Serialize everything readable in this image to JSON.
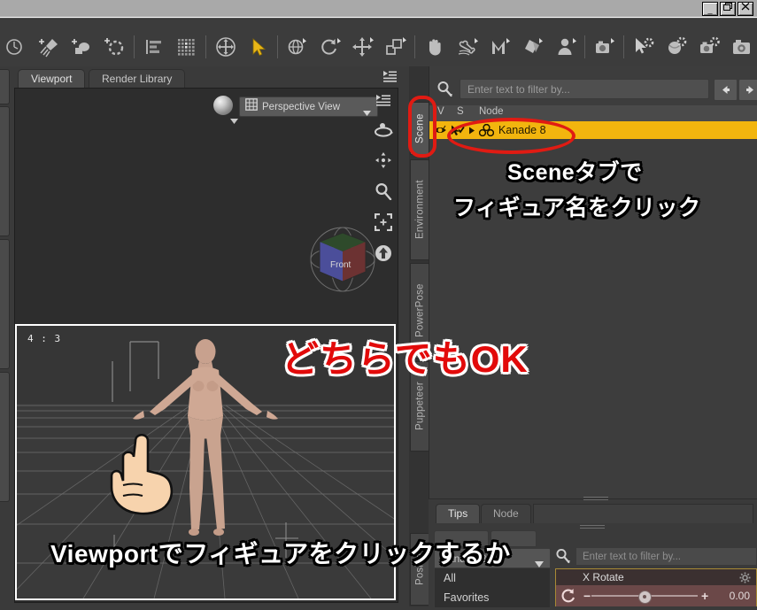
{
  "window": {
    "buttons": [
      {
        "name": "minimize-button",
        "glyph": "_"
      },
      {
        "name": "restore-button",
        "glyph": "❐"
      },
      {
        "name": "close-button",
        "glyph": "✕"
      }
    ]
  },
  "toolbar": {
    "icons": [
      {
        "name": "render-settings-icon",
        "title": "Render Settings"
      },
      {
        "name": "create-light-icon",
        "title": "Create Light"
      },
      {
        "name": "create-camera-icon",
        "title": "Create Camera"
      },
      {
        "name": "create-null-icon",
        "title": "Create Null"
      },
      {
        "name": "align-icon",
        "title": "Align"
      },
      {
        "name": "grid-snap-icon",
        "title": "Grid"
      },
      {
        "name": "universal-tool-icon",
        "title": "Universal Tool"
      },
      {
        "name": "node-selection-icon",
        "title": "Node Selection Tool"
      },
      {
        "name": "rotate-orbit-icon",
        "title": "Rotate"
      },
      {
        "name": "rotate-tool-icon",
        "title": "Rotate Tool"
      },
      {
        "name": "translate-tool-icon",
        "title": "Translate Tool"
      },
      {
        "name": "scale-tool-icon",
        "title": "Scale Tool"
      },
      {
        "name": "pan-hand-icon",
        "title": "Hand / Pan"
      },
      {
        "name": "bone-tool-icon",
        "title": "Joint Editor"
      },
      {
        "name": "morph-tool-icon",
        "title": "Morph Tool"
      },
      {
        "name": "surface-tool-icon",
        "title": "Surface Selection"
      },
      {
        "name": "figure-tool-icon",
        "title": "Figure Tool"
      },
      {
        "name": "camera-tool-icon",
        "title": "Camera Tool"
      },
      {
        "name": "selection-options-icon",
        "title": "Selection Options"
      },
      {
        "name": "render-preview-icon",
        "title": "Preview Render"
      },
      {
        "name": "render-settings-camera-icon",
        "title": "Render Settings"
      },
      {
        "name": "render-icon",
        "title": "Render"
      },
      {
        "name": "daz-studio-logo-icon",
        "title": "DAZ Studio"
      },
      {
        "name": "toolbar-overflow-icon",
        "title": "More"
      }
    ],
    "active_index": 7
  },
  "viewport": {
    "tabs": [
      {
        "label": "Viewport",
        "selected": true
      },
      {
        "label": "Render Library",
        "selected": false
      }
    ],
    "view_selector": "Perspective View",
    "viewcube_label": "Front",
    "aspect_ratio": "4 : 3",
    "side_tools": [
      {
        "name": "viewport-menu-icon"
      },
      {
        "name": "orbit-icon"
      },
      {
        "name": "pan-icon"
      },
      {
        "name": "zoom-icon"
      },
      {
        "name": "frame-icon"
      },
      {
        "name": "reset-view-icon"
      }
    ]
  },
  "vertical_tabs": [
    {
      "label": "Scene",
      "selected": true
    },
    {
      "label": "Environment",
      "selected": false
    },
    {
      "label": "PowerPose",
      "selected": false
    },
    {
      "label": "Puppeteer",
      "selected": false
    },
    {
      "label": "Posing",
      "selected": false
    }
  ],
  "scene_pane": {
    "filter_placeholder": "Enter text to filter by...",
    "filter_value": "",
    "nav_prev": "◀",
    "nav_next": "▶",
    "columns": [
      "V",
      "S",
      "Node"
    ],
    "rows": [
      {
        "node": "Kanade 8",
        "selected": true
      }
    ]
  },
  "tips_pane": {
    "tabs": [
      {
        "label": "Tips",
        "selected": true
      },
      {
        "label": "Node",
        "selected": false
      }
    ]
  },
  "posing_pane": {
    "figure_selector": "Kanade 8",
    "list_items": [
      "All",
      "Favorites"
    ],
    "param_filter_placeholder": "Enter text to filter by...",
    "parameter": {
      "label": "X Rotate",
      "value": "0.00",
      "minus": "−",
      "plus": "+"
    }
  },
  "annotations": {
    "scene_tab_line1": "Sceneタブで",
    "scene_tab_line2": "フィギュア名をクリック",
    "either_ok": "どちらでもOK",
    "viewport_click": "Viewportでフィギュアをクリックするか"
  },
  "colors": {
    "accent_selected": "#f2b50e",
    "annotation_red": "#e20a0a",
    "circle_red": "#e01b13",
    "panel_bg": "#3d3d3d",
    "toolbar_bg": "#3c3c3c"
  }
}
